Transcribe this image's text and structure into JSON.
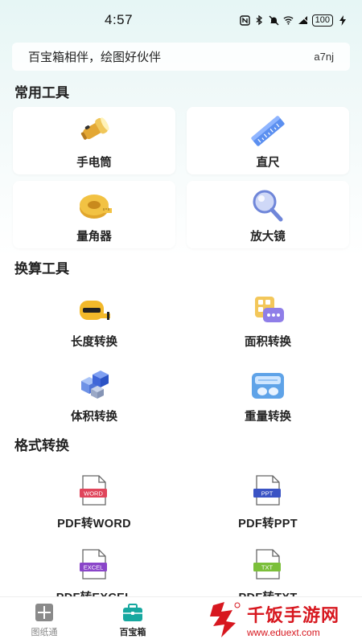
{
  "status_bar": {
    "time": "4:57",
    "battery": "100"
  },
  "banner": {
    "slogan": "百宝箱相伴，绘图好伙伴",
    "code": "a7nj"
  },
  "sections": {
    "common": {
      "title": "常用工具",
      "items": [
        {
          "label": "手电筒",
          "icon": "flashlight-icon"
        },
        {
          "label": "直尺",
          "icon": "ruler-icon"
        },
        {
          "label": "量角器",
          "icon": "tape-measure-icon"
        },
        {
          "label": "放大镜",
          "icon": "magnifier-icon"
        }
      ]
    },
    "convert": {
      "title": "换算工具",
      "items": [
        {
          "label": "长度转换",
          "icon": "tape-measure-icon"
        },
        {
          "label": "面积转换",
          "icon": "calculator-icon"
        },
        {
          "label": "体积转换",
          "icon": "cubes-icon"
        },
        {
          "label": "重量转换",
          "icon": "scale-icon"
        }
      ]
    },
    "format": {
      "title": "格式转换",
      "items": [
        {
          "label": "PDF转WORD",
          "badge": "WORD",
          "color": "#e0455b"
        },
        {
          "label": "PDF转PPT",
          "badge": "PPT",
          "color": "#3a53c4"
        },
        {
          "label": "PDF转EXCEL",
          "badge": "EXCEL",
          "color": "#8a45c9"
        },
        {
          "label": "PDF转TXT",
          "badge": "TXT",
          "color": "#7bbf3a"
        }
      ]
    }
  },
  "bottom_nav": {
    "items": [
      {
        "label": "图纸通",
        "active": false
      },
      {
        "label": "百宝箱",
        "active": true
      }
    ]
  },
  "watermark": {
    "title": "千饭手游网",
    "url": "www.eduext.com"
  },
  "colors": {
    "accent": "#17a8a0",
    "background_top": "#e6f6f5"
  }
}
